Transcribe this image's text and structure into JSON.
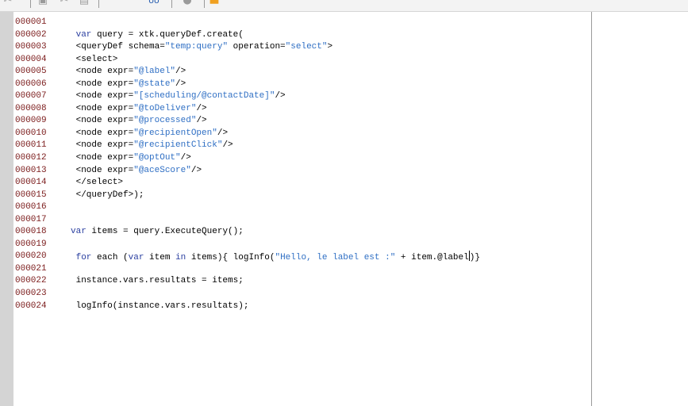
{
  "toolbar": {
    "buttons": [
      {
        "name": "cut-icon",
        "glyph": "✂"
      },
      {
        "name": "paste-icon",
        "glyph": "📋"
      },
      {
        "name": "cut-icon-2",
        "glyph": "✂"
      },
      {
        "name": "copy-icon",
        "glyph": "▤"
      },
      {
        "name": "find-icon",
        "glyph": "oo"
      },
      {
        "name": "help-icon",
        "glyph": "?"
      },
      {
        "name": "color-icon",
        "glyph": "■"
      }
    ],
    "accent_color": "#f0a020"
  },
  "editor": {
    "lines": [
      {
        "num": "000001",
        "segments": []
      },
      {
        "num": "000002",
        "segments": [
          {
            "t": " ",
            "c": ""
          },
          {
            "t": "var",
            "c": "kw"
          },
          {
            "t": " query = xtk.queryDef.create(",
            "c": ""
          }
        ]
      },
      {
        "num": "000003",
        "segments": [
          {
            "t": " <queryDef schema=",
            "c": ""
          },
          {
            "t": "\"temp:query\"",
            "c": "str"
          },
          {
            "t": " operation=",
            "c": ""
          },
          {
            "t": "\"select\"",
            "c": "str"
          },
          {
            "t": ">",
            "c": ""
          }
        ]
      },
      {
        "num": "000004",
        "segments": [
          {
            "t": " <select>",
            "c": ""
          }
        ]
      },
      {
        "num": "000005",
        "segments": [
          {
            "t": " <node expr=",
            "c": ""
          },
          {
            "t": "\"@label\"",
            "c": "str"
          },
          {
            "t": "/>",
            "c": ""
          }
        ]
      },
      {
        "num": "000006",
        "segments": [
          {
            "t": " <node expr=",
            "c": ""
          },
          {
            "t": "\"@state\"",
            "c": "str"
          },
          {
            "t": "/>",
            "c": ""
          }
        ]
      },
      {
        "num": "000007",
        "segments": [
          {
            "t": " <node expr=",
            "c": ""
          },
          {
            "t": "\"[scheduling/@contactDate]\"",
            "c": "str"
          },
          {
            "t": "/>",
            "c": ""
          }
        ]
      },
      {
        "num": "000008",
        "segments": [
          {
            "t": " <node expr=",
            "c": ""
          },
          {
            "t": "\"@toDeliver\"",
            "c": "str"
          },
          {
            "t": "/>",
            "c": ""
          }
        ]
      },
      {
        "num": "000009",
        "segments": [
          {
            "t": " <node expr=",
            "c": ""
          },
          {
            "t": "\"@processed\"",
            "c": "str"
          },
          {
            "t": "/>",
            "c": ""
          }
        ]
      },
      {
        "num": "000010",
        "segments": [
          {
            "t": " <node expr=",
            "c": ""
          },
          {
            "t": "\"@recipientOpen\"",
            "c": "str"
          },
          {
            "t": "/>",
            "c": ""
          }
        ]
      },
      {
        "num": "000011",
        "segments": [
          {
            "t": " <node expr=",
            "c": ""
          },
          {
            "t": "\"@recipientClick\"",
            "c": "str"
          },
          {
            "t": "/>",
            "c": ""
          }
        ]
      },
      {
        "num": "000012",
        "segments": [
          {
            "t": " <node expr=",
            "c": ""
          },
          {
            "t": "\"@optOut\"",
            "c": "str"
          },
          {
            "t": "/>",
            "c": ""
          }
        ]
      },
      {
        "num": "000013",
        "segments": [
          {
            "t": " <node expr=",
            "c": ""
          },
          {
            "t": "\"@aceScore\"",
            "c": "str"
          },
          {
            "t": "/>",
            "c": ""
          }
        ]
      },
      {
        "num": "000014",
        "segments": [
          {
            "t": " </select>",
            "c": ""
          }
        ]
      },
      {
        "num": "000015",
        "segments": [
          {
            "t": " </queryDef>);",
            "c": ""
          }
        ]
      },
      {
        "num": "000016",
        "segments": []
      },
      {
        "num": "000017",
        "segments": []
      },
      {
        "num": "000018",
        "segments": [
          {
            "t": "var",
            "c": "kw"
          },
          {
            "t": " items = query.ExecuteQuery();",
            "c": ""
          }
        ]
      },
      {
        "num": "000019",
        "segments": []
      },
      {
        "num": "000020",
        "segments": [
          {
            "t": " ",
            "c": ""
          },
          {
            "t": "for",
            "c": "kw"
          },
          {
            "t": " each (",
            "c": ""
          },
          {
            "t": "var",
            "c": "kw"
          },
          {
            "t": " item ",
            "c": ""
          },
          {
            "t": "in",
            "c": "kw"
          },
          {
            "t": " items){ logInfo(",
            "c": ""
          },
          {
            "t": "\"Hello, le label est :\"",
            "c": "str"
          },
          {
            "t": " + item.@label",
            "c": ""
          },
          {
            "t": "|",
            "c": "cursor"
          },
          {
            "t": ")}",
            "c": ""
          }
        ]
      },
      {
        "num": "000021",
        "segments": []
      },
      {
        "num": "000022",
        "segments": [
          {
            "t": " instance.vars.resultats = items;",
            "c": ""
          }
        ]
      },
      {
        "num": "000023",
        "segments": []
      },
      {
        "num": "000024",
        "segments": [
          {
            "t": " logInfo(instance.vars.resultats);",
            "c": ""
          }
        ]
      }
    ]
  }
}
